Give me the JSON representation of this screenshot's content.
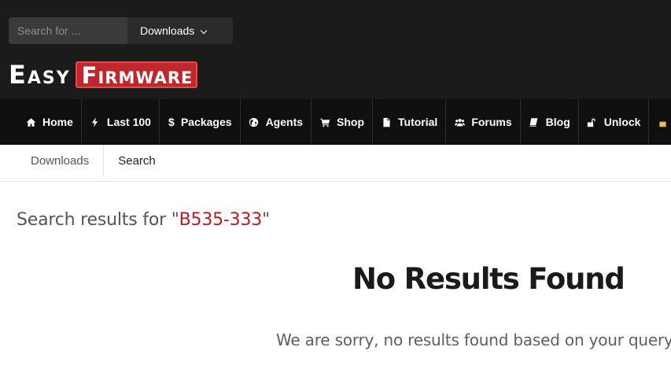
{
  "search": {
    "placeholder": "Search for ..."
  },
  "dropdown": {
    "selected": "Downloads"
  },
  "logo": {
    "easy_first": "E",
    "easy_rest": "ASY",
    "firm_first": "F",
    "firm_rest": "IRMWARE"
  },
  "nav": {
    "items": [
      {
        "label": "Home",
        "icon": "home-icon"
      },
      {
        "label": "Last 100",
        "icon": "bolt-icon"
      },
      {
        "label": "Packages",
        "icon": "dollar-icon"
      },
      {
        "label": "Agents",
        "icon": "globe-icon"
      },
      {
        "label": "Shop",
        "icon": "cart-icon"
      },
      {
        "label": "Tutorial",
        "icon": "file-icon"
      },
      {
        "label": "Forums",
        "icon": "users-icon"
      },
      {
        "label": "Blog",
        "icon": "book-icon"
      },
      {
        "label": "Unlock",
        "icon": "unlock-icon"
      }
    ]
  },
  "breadcrumb": {
    "items": [
      "Downloads",
      "Search"
    ]
  },
  "results": {
    "prefix": "Search results for \"",
    "query": "B535-333",
    "suffix": "\"",
    "no_results_title": "No Results Found",
    "no_results_message": "We are sorry, no results found based on your query"
  },
  "colors": {
    "brand_red": "#c0272d",
    "query_red": "#b01e23",
    "header_bg": "#1b1b1b",
    "nav_bg": "#0f0f0f"
  }
}
